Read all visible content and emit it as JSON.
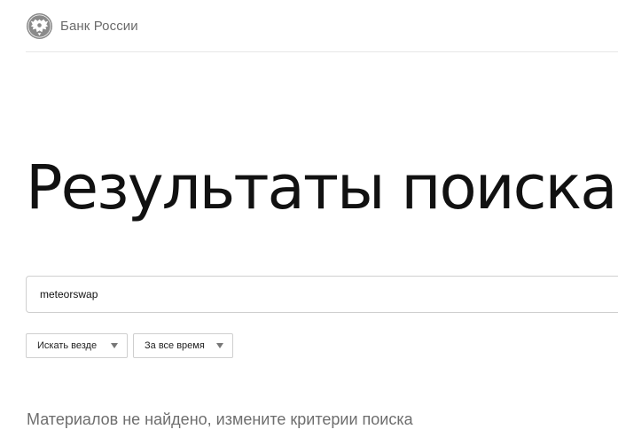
{
  "header": {
    "brand": "Банк России",
    "logo_icon": "double-headed-eagle-emblem-icon"
  },
  "main": {
    "title": "Результаты поиска",
    "search": {
      "value": "meteorswap",
      "placeholder": ""
    },
    "filters": [
      {
        "label": "Искать везде",
        "icon": "chevron-down-icon"
      },
      {
        "label": "За все время",
        "icon": "chevron-down-icon"
      }
    ],
    "empty_message": "Материалов не найдено, измените критерии поиска"
  },
  "colors": {
    "text": "#111111",
    "muted": "#6e6e6e",
    "border": "#cfcfcf"
  }
}
